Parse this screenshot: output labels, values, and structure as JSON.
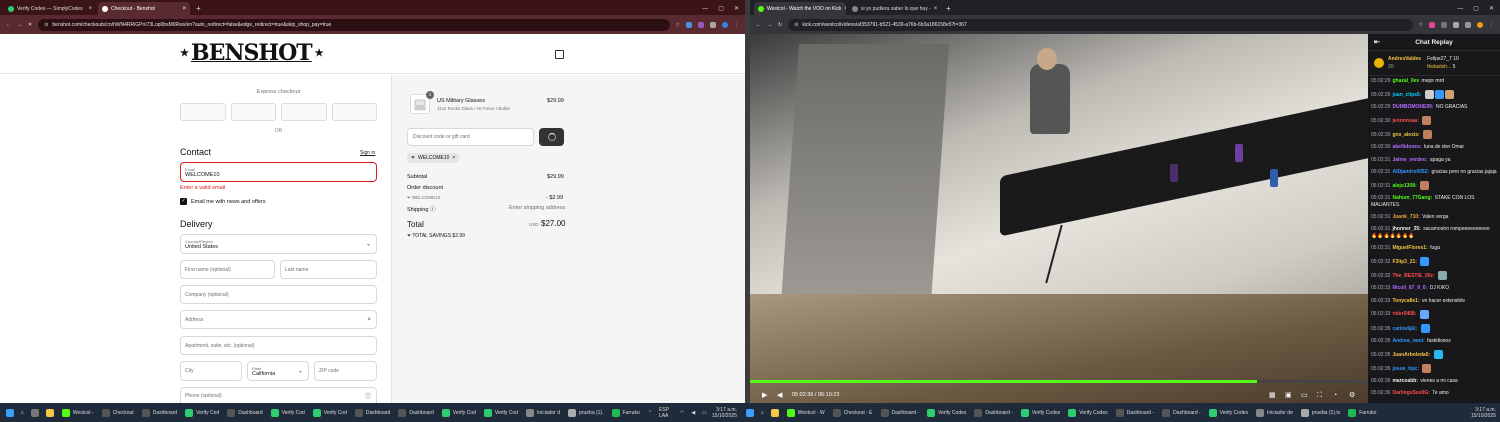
{
  "left_window": {
    "tabs": [
      {
        "label": "Verify Codes — SimplyCodes",
        "color": "#2ecc71"
      },
      {
        "label": "Checkout - Benshot",
        "color": "#111111"
      }
    ],
    "url": "benshot.com/checkouts/cn/hWN4RRiGPnI73Lop0bsM0Rws/en?auto_redirect=false&edge_redirect=true&skip_shop_pay=true",
    "brand": "BENSHOT",
    "brand_stars": "★",
    "express_checkout": "Express checkout",
    "or_label": "OR",
    "contact_heading": "Contact",
    "sign_in": "Sign in",
    "email_label": "Email",
    "email_value": "WELCOME10",
    "email_error": "Enter a valid email",
    "newsletter": "Email me with news and offers",
    "delivery_heading": "Delivery",
    "country_label": "Country/Region",
    "country_value": "United States",
    "first_name": "First name (optional)",
    "last_name": "Last name",
    "company": "Company (optional)",
    "address": "Address",
    "apartment": "Apartment, suite, etc. (optional)",
    "city": "City",
    "state_label": "State",
    "state_value": "California",
    "zip": "ZIP code",
    "phone": "Phone (optional)",
    "summary": {
      "qty": "1",
      "product_name": "US Military Glasses",
      "product_variant": "11oz Rocks Glass / Air Force / Bullet",
      "product_price": "$29.99",
      "discount_placeholder": "Discount code or gift card",
      "applied_code": "WELCOME10",
      "subtotal_label": "Subtotal",
      "subtotal_value": "$29.99",
      "order_discount_label": "Order discount",
      "discount_code": "WELCOME10",
      "discount_value": "- $2.99",
      "shipping_label": "Shipping",
      "shipping_value": "Enter shipping address",
      "total_label": "Total",
      "currency": "USD",
      "total_value": "$27.00",
      "savings_label": "TOTAL SAVINGS",
      "savings_value": "$2.99"
    }
  },
  "right_window": {
    "tabs": [
      {
        "label": "Westcol - Watch the VOD on Kick",
        "color": "#53fc18"
      },
      {
        "label": "si yo pudiera saber lo que hay -",
        "color": "#888888"
      }
    ],
    "url": "kick.com/westcol/videos/af353791-b521-4539-a76b-6b3a186158e5?t=367",
    "video_time": "05:02:36 / 06:10:23",
    "progress_fraction": 0.82,
    "chat_title": "Chat Replay",
    "pinned_user": "AndresValdes",
    "pinned_count": "20",
    "pinned_gifter": "Felipe27_7",
    "pinned_gifter_count": "10",
    "pinned_gifter2": "thelastsh...",
    "pinned_gifter2_count": "5",
    "messages": [
      {
        "ts": "05:02:29",
        "user": "ghazal_llev",
        "color": "#53fc18",
        "text": "mejor mrd",
        "emotes": []
      },
      {
        "ts": "05:02:29",
        "user": "juan_clips5:",
        "color": "#00d1ff",
        "text": "",
        "emotes": [
          "#ccc",
          "#3399ff",
          "#d0a070"
        ]
      },
      {
        "ts": "05:02:29",
        "user": "DUMBOMONE99:",
        "color": "#b56bff",
        "text": "NO GRACIAS",
        "emotes": []
      },
      {
        "ts": "05:02:30",
        "user": "jennnnsaa:",
        "color": "#ff4f4f",
        "text": "",
        "emotes": [
          "#c08060"
        ]
      },
      {
        "ts": "05:02:30",
        "user": "gnx_alexis:",
        "color": "#f4c542",
        "text": "",
        "emotes": [
          "#c08060"
        ]
      },
      {
        "ts": "05:02:30",
        "user": "abellidones:",
        "color": "#b56bff",
        "text": "luna de don Omar",
        "emotes": []
      },
      {
        "ts": "05:02:31",
        "user": "Jaime_verdeo:",
        "color": "#b56bff",
        "text": "apaga ya",
        "emotes": []
      },
      {
        "ts": "05:02:31",
        "user": "AlDjandro0052:",
        "color": "#3399ff",
        "text": "gracias pero no gracias jajaja",
        "emotes": []
      },
      {
        "ts": "05:02:31",
        "user": "alejo1308:",
        "color": "#53fc18",
        "text": "",
        "emotes": [
          "#c08060"
        ]
      },
      {
        "ts": "05:02:31",
        "user": "Nahum_77Gang:",
        "color": "#53fc18",
        "text": "STAKE CON LOS MALIANTES",
        "emotes": []
      },
      {
        "ts": "05:02:31",
        "user": "Juank_710:",
        "color": "#f4a742",
        "text": "Valen verga",
        "emotes": []
      },
      {
        "ts": "05:02:31",
        "user": "jhonner_35:",
        "color": "#efeff1",
        "text": "sacamostro rompeeeeeeeeee 🔥🔥🔥🔥🔥🔥🔥",
        "emotes": []
      },
      {
        "ts": "05:02:31",
        "user": "MiguelFlores1:",
        "color": "#f4c542",
        "text": "fuga",
        "emotes": []
      },
      {
        "ts": "05:02:32",
        "user": "F3lip3_21:",
        "color": "#f4c542",
        "text": "",
        "emotes": [
          "#3399ff"
        ]
      },
      {
        "ts": "05:02:32",
        "user": "The_BESTIE_00z:",
        "color": "#ff4f4f",
        "text": "",
        "emotes": [
          "#8aa"
        ]
      },
      {
        "ts": "05:02:33",
        "user": "Nicoll_87_9_0:",
        "color": "#b56bff",
        "text": "DJ KIKO",
        "emotes": []
      },
      {
        "ts": "05:02:33",
        "user": "Tonycalle1:",
        "color": "#f4c542",
        "text": "ve hacer extensible",
        "emotes": []
      },
      {
        "ts": "05:02:33",
        "user": "rider5458:",
        "color": "#ff4f4f",
        "text": "",
        "emotes": [
          "#6af"
        ]
      },
      {
        "ts": "05:02:35",
        "user": "carlos5jkl:",
        "color": "#3399ff",
        "text": "",
        "emotes": [
          "#3399ff"
        ]
      },
      {
        "ts": "05:02:35",
        "user": "Andrea_rami:",
        "color": "#3399ff",
        "text": "fastidiosos",
        "emotes": []
      },
      {
        "ts": "05:02:35",
        "user": "JuanArboleda0:",
        "color": "#f4c542",
        "text": "",
        "emotes": [
          "#2ab7f0"
        ]
      },
      {
        "ts": "05:02:35",
        "user": "josue_hpc:",
        "color": "#3399ff",
        "text": "",
        "emotes": [
          "#c08060"
        ]
      },
      {
        "ts": "05:02:36",
        "user": "marcoabb:",
        "color": "#efeff1",
        "text": "vienes a mi casa",
        "emotes": []
      },
      {
        "ts": "05:02:36",
        "user": "DarlingsSus0G:",
        "color": "#ff4f4f",
        "text": "Te amo",
        "emotes": []
      }
    ]
  },
  "taskbar": {
    "left_items": [
      {
        "label": "Westcol -",
        "color": "#53fc18"
      },
      {
        "label": "Checkout",
        "color": "#555"
      },
      {
        "label": "Dashboard",
        "color": "#555"
      },
      {
        "label": "Verify Cod",
        "color": "#2ecc71"
      },
      {
        "label": "Dashboard",
        "color": "#555"
      },
      {
        "label": "Verify Cod",
        "color": "#2ecc71"
      },
      {
        "label": "Verify Cod",
        "color": "#2ecc71"
      },
      {
        "label": "Dashboard",
        "color": "#555"
      },
      {
        "label": "Dashboard",
        "color": "#555"
      },
      {
        "label": "Verify Cod",
        "color": "#2ecc71"
      },
      {
        "label": "Verify Cod",
        "color": "#2ecc71"
      },
      {
        "label": "Iniciador d",
        "color": "#888"
      },
      {
        "label": "prueba (1).",
        "color": "#aaa"
      },
      {
        "label": "Farruko",
        "color": "#1db954"
      }
    ],
    "lang": "ESP LAA",
    "time": "3:17 a.m.",
    "date": "15/10/2025",
    "right_items": [
      {
        "label": "Westcol - W",
        "color": "#53fc18"
      },
      {
        "label": "Checkout - E",
        "color": "#555"
      },
      {
        "label": "Dashboard -",
        "color": "#555"
      },
      {
        "label": "Verify Codes",
        "color": "#2ecc71"
      },
      {
        "label": "Dashboard -",
        "color": "#555"
      },
      {
        "label": "Verify Codes",
        "color": "#2ecc71"
      },
      {
        "label": "Verify Codes",
        "color": "#2ecc71"
      },
      {
        "label": "Dashboard -",
        "color": "#555"
      },
      {
        "label": "Dashboard -",
        "color": "#555"
      },
      {
        "label": "Verify Codes",
        "color": "#2ecc71"
      },
      {
        "label": "Iniciador de",
        "color": "#888"
      },
      {
        "label": "prueba (1).tx",
        "color": "#aaa"
      },
      {
        "label": "Farruko",
        "color": "#1db954"
      }
    ],
    "time2": "3:17 a.m.",
    "date2": "15/10/2025"
  }
}
